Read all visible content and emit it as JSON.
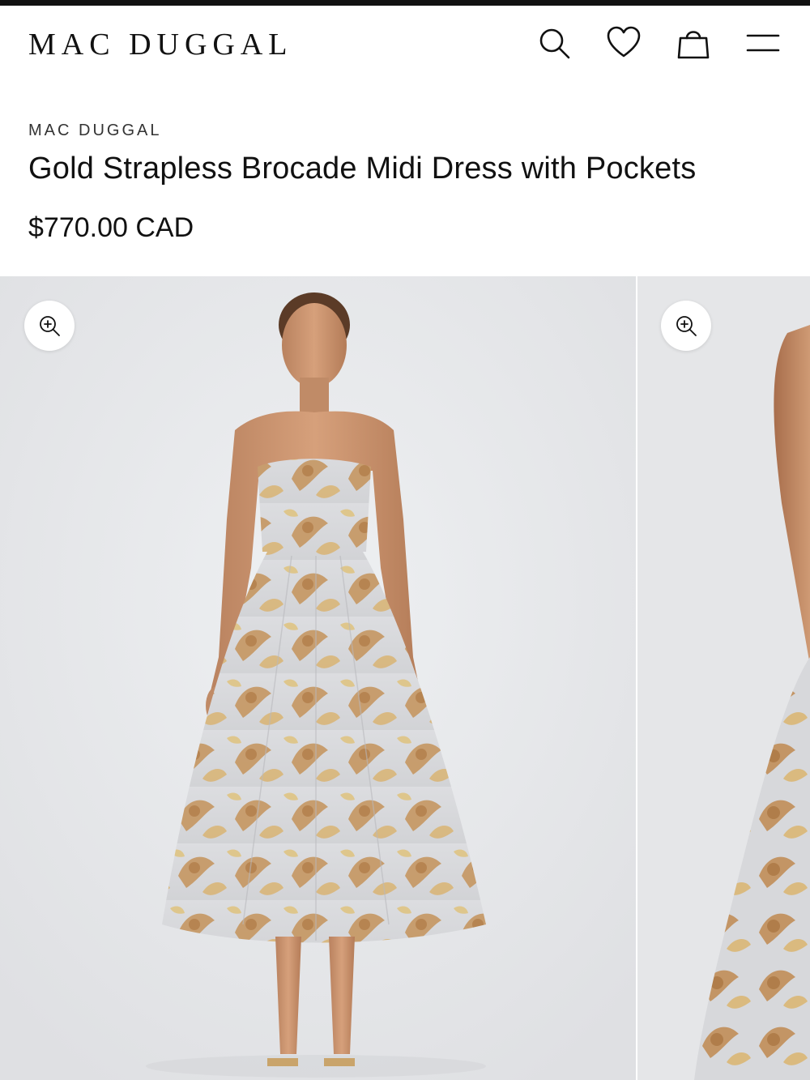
{
  "header": {
    "logo": "MAC DUGGAL",
    "icons": [
      "search-icon",
      "heart-icon",
      "shopping-bag-icon",
      "menu-icon"
    ]
  },
  "product": {
    "brand": "MAC DUGGAL",
    "title": "Gold Strapless Brocade Midi Dress with Pockets",
    "price": "$770.00 CAD"
  },
  "gallery": {
    "images": [
      {
        "alt": "Model wearing gold strapless brocade midi dress, front view",
        "zoom_icon": "zoom-in-icon"
      },
      {
        "alt": "Model wearing gold strapless brocade midi dress, side view",
        "zoom_icon": "zoom-in-icon"
      }
    ]
  },
  "colors": {
    "text": "#111111",
    "photo_background": "#e6e7e9",
    "dress_base": "#d9dadc",
    "brocade_gold": "#c4935a"
  }
}
